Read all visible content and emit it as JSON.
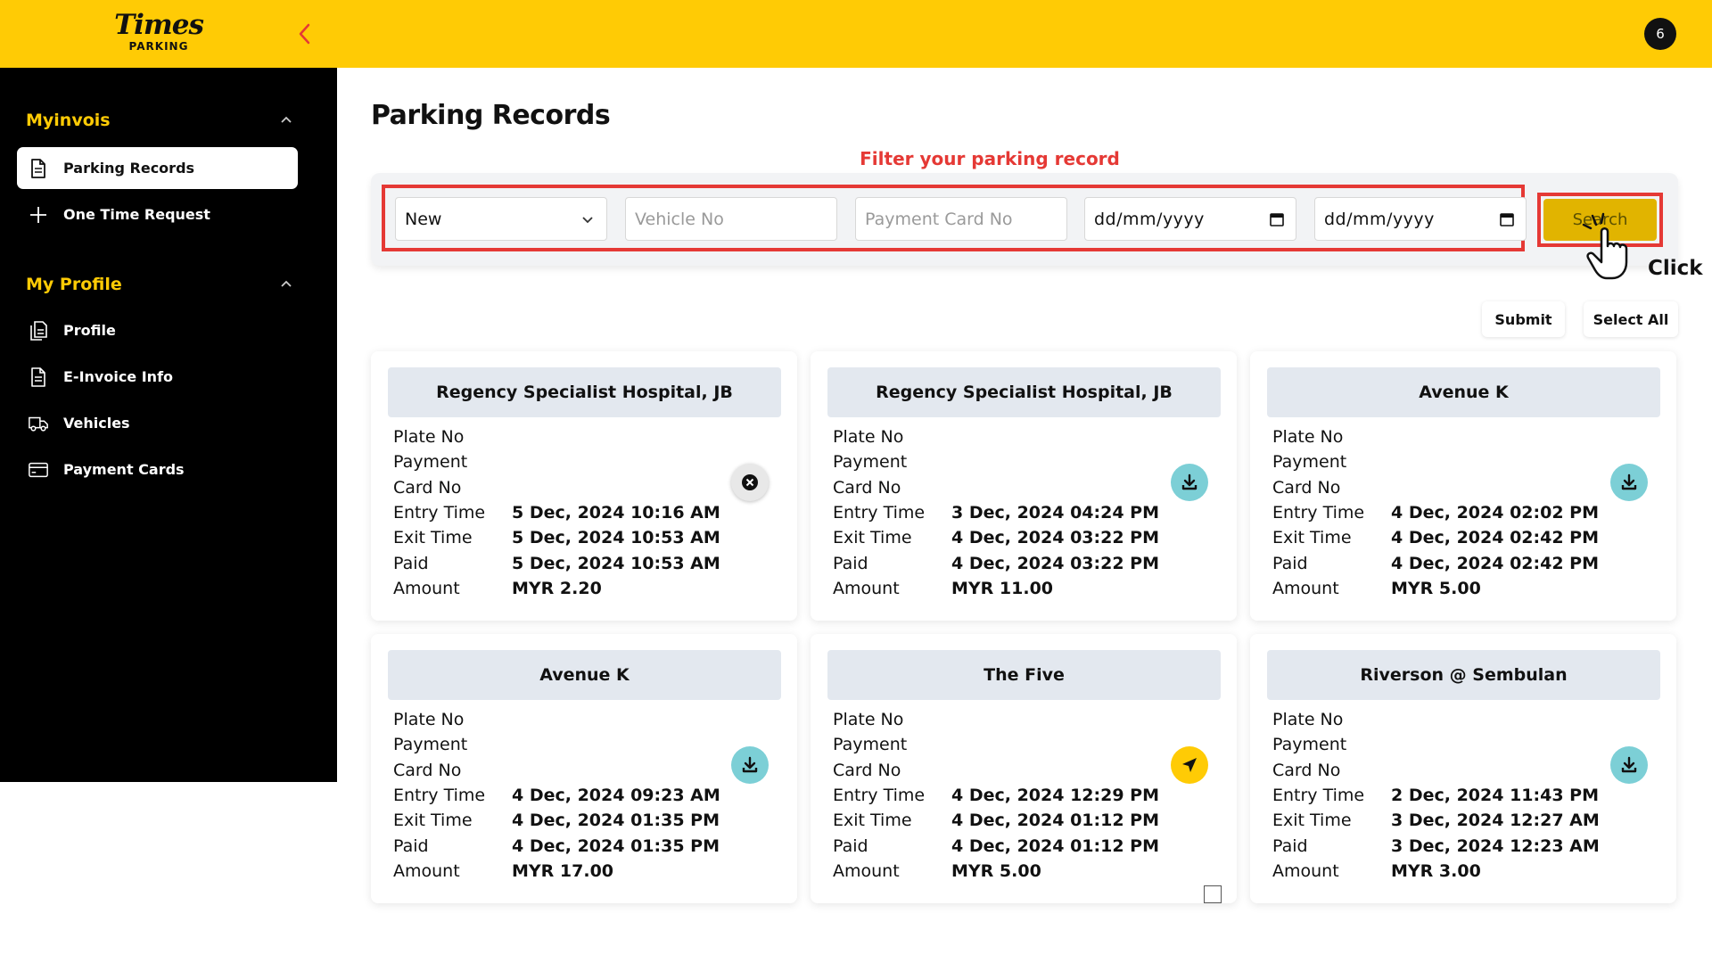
{
  "header": {
    "logo_main": "Times",
    "logo_sub": "PARKING",
    "avatar_text": "6"
  },
  "sidebar": {
    "section1_title": "Myinvois",
    "section1_items": [
      {
        "label": "Parking Records",
        "icon": "document-icon",
        "active": true
      },
      {
        "label": "One Time Request",
        "icon": "plus-icon",
        "active": false
      }
    ],
    "section2_title": "My Profile",
    "section2_items": [
      {
        "label": "Profile",
        "icon": "profile-document-icon"
      },
      {
        "label": "E-Invoice Info",
        "icon": "invoice-document-icon"
      },
      {
        "label": "Vehicles",
        "icon": "truck-icon"
      },
      {
        "label": "Payment Cards",
        "icon": "credit-card-icon"
      }
    ]
  },
  "main": {
    "title": "Parking Records",
    "filter_hint": "Filter your parking record",
    "filters": {
      "status_value": "New",
      "vehicle_placeholder": "Vehicle No",
      "card_placeholder": "Payment Card No",
      "date_from_placeholder": "dd/mm/yyyy",
      "date_to_placeholder": "dd/mm/yyyy"
    },
    "search_label": "Search",
    "click_annotation": "Click",
    "submit_label": "Submit",
    "select_all_label": "Select All"
  },
  "field_labels": {
    "plate": "Plate No",
    "payment": "Payment",
    "card": "Card No",
    "entry": "Entry Time",
    "exit": "Exit Time",
    "paid": "Paid",
    "amount": "Amount"
  },
  "records": [
    {
      "location": "Regency Specialist Hospital, JB",
      "entry": "5 Dec, 2024 10:16 AM",
      "exit": "5 Dec, 2024 10:53 AM",
      "paid": "5 Dec, 2024 10:53 AM",
      "amount": "MYR 2.20",
      "status": "cancel",
      "status_color": "#E8E8E8"
    },
    {
      "location": "Regency Specialist Hospital, JB",
      "entry": "3 Dec, 2024 04:24 PM",
      "exit": "4 Dec, 2024 03:22 PM",
      "paid": "4 Dec, 2024 03:22 PM",
      "amount": "MYR 11.00",
      "status": "download",
      "status_color": "#7CCFD6"
    },
    {
      "location": "Avenue K",
      "entry": "4 Dec, 2024 02:02 PM",
      "exit": "4 Dec, 2024 02:42 PM",
      "paid": "4 Dec, 2024 02:42 PM",
      "amount": "MYR 5.00",
      "status": "download",
      "status_color": "#7CCFD6"
    },
    {
      "location": "Avenue K",
      "entry": "4 Dec, 2024 09:23 AM",
      "exit": "4 Dec, 2024 01:35 PM",
      "paid": "4 Dec, 2024 01:35 PM",
      "amount": "MYR 17.00",
      "status": "download",
      "status_color": "#7CCFD6"
    },
    {
      "location": "The Five",
      "entry": "4 Dec, 2024 12:29 PM",
      "exit": "4 Dec, 2024 01:12 PM",
      "paid": "4 Dec, 2024 01:12 PM",
      "amount": "MYR 5.00",
      "status": "send",
      "status_color": "#FFCB05",
      "has_checkbox": true
    },
    {
      "location": "Riverson @ Sembulan",
      "entry": "2 Dec, 2024 11:43 PM",
      "exit": "3 Dec, 2024 12:27 AM",
      "paid": "3 Dec, 2024 12:23 AM",
      "amount": "MYR 3.00",
      "status": "download",
      "status_color": "#7CCFD6"
    }
  ],
  "colors": {
    "brand_yellow": "#FFCB05",
    "annotation_red": "#E53935",
    "sidebar_black": "#000000"
  }
}
